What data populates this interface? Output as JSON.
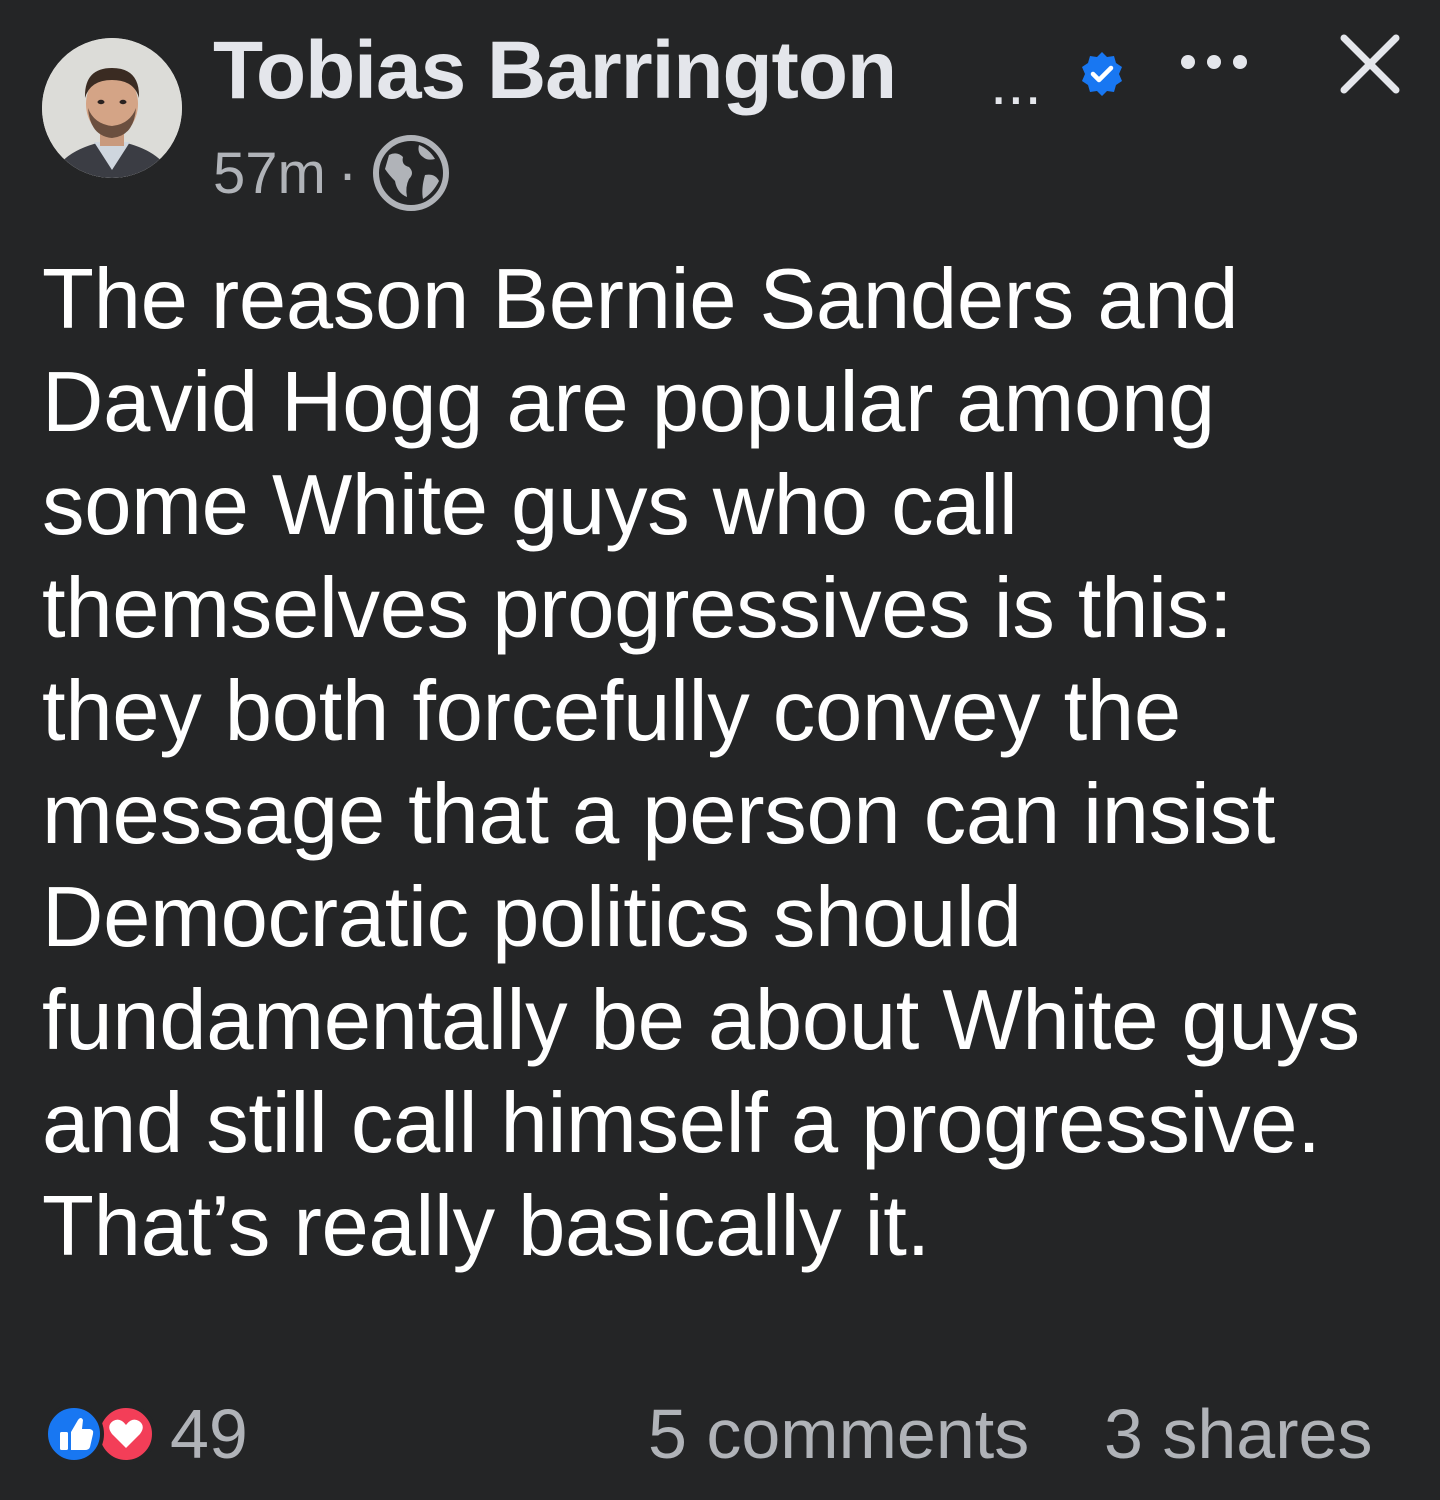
{
  "post": {
    "author_name": "Tobias Barrington",
    "author_name_truncation": "...",
    "verified": true,
    "timestamp": "57m",
    "meta_separator": "·",
    "privacy_icon": "globe-icon",
    "body": "The reason Bernie Sanders and David Hogg are popular among some White guys who call themselves progressives is this: they both forcefully convey the message that a person can insist Democratic politics should fundamentally be about White guys and still call himself a progressive. That’s really basically it."
  },
  "header_actions": {
    "more_icon": "more-horizontal-icon",
    "close_icon": "close-icon"
  },
  "engagement": {
    "reaction_icons": [
      "like-icon",
      "love-icon"
    ],
    "reaction_count": "49",
    "comments": "5 comments",
    "shares": "3 shares"
  },
  "colors": {
    "background": "#242526",
    "primary_text": "#e4e6eb",
    "secondary_text": "#b0b3b8",
    "verified_blue": "#1877f2",
    "like_blue": "#1877f2",
    "love_red": "#f33e58"
  }
}
